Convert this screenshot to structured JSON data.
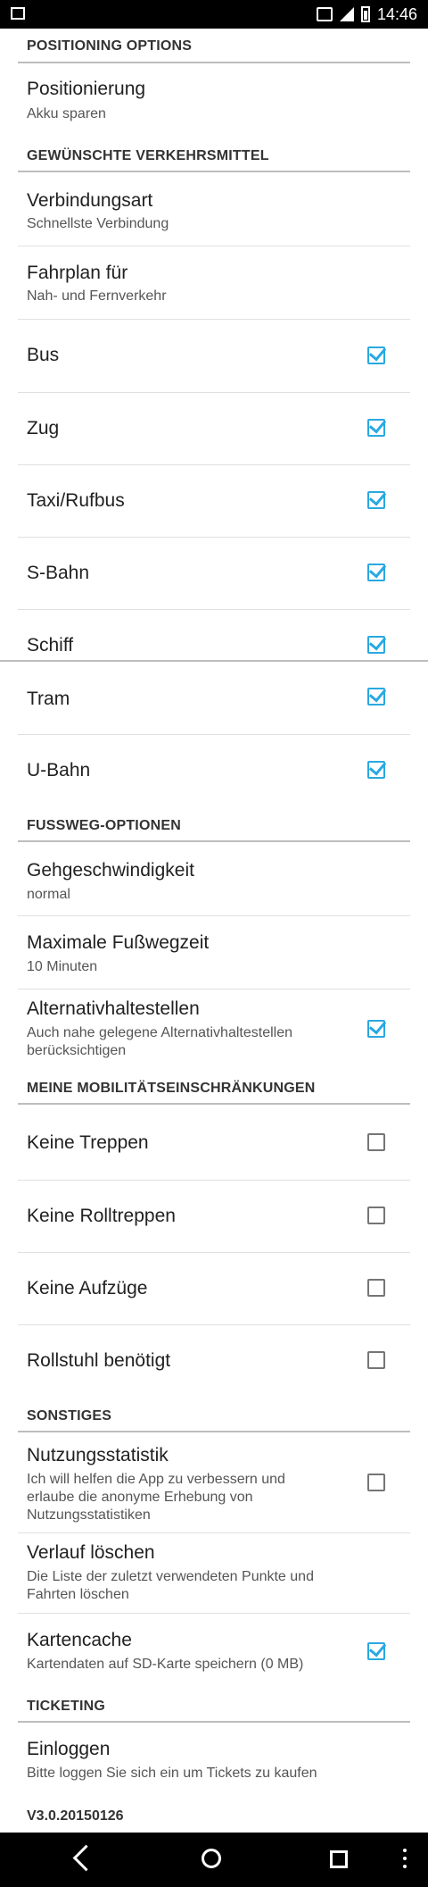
{
  "status_bar": {
    "time": "14:46"
  },
  "sections": {
    "positioning": {
      "header": "POSITIONING OPTIONS"
    },
    "transport": {
      "header": "GEWÜNSCHTE VERKEHRSMITTEL"
    },
    "walking": {
      "header": "FUSSWEG-OPTIONEN"
    },
    "mobility": {
      "header": "MEINE MOBILITÄTSEINSCHRÄNKUNGEN"
    },
    "misc": {
      "header": "SONSTIGES"
    },
    "ticketing": {
      "header": "TICKETING"
    }
  },
  "items": {
    "positionierung": {
      "title": "Positionierung",
      "subtitle": "Akku sparen"
    },
    "verbindungsart": {
      "title": "Verbindungsart",
      "subtitle": "Schnellste Verbindung"
    },
    "fahrplan": {
      "title": "Fahrplan für",
      "subtitle": "Nah- und Fernverkehr"
    },
    "bus": {
      "title": "Bus",
      "checked": true
    },
    "zug": {
      "title": "Zug",
      "checked": true
    },
    "taxi": {
      "title": "Taxi/Rufbus",
      "checked": true
    },
    "sbahn": {
      "title": "S-Bahn",
      "checked": true
    },
    "schiff": {
      "title": "Schiff",
      "checked": true
    },
    "tram": {
      "title": "Tram",
      "checked": true
    },
    "ubahn": {
      "title": "U-Bahn",
      "checked": true
    },
    "gehgeschwindigkeit": {
      "title": "Gehgeschwindigkeit",
      "subtitle": "normal"
    },
    "fusswegzeit": {
      "title": "Maximale Fußwegzeit",
      "subtitle": "10 Minuten"
    },
    "alternativ": {
      "title": "Alternativhaltestellen",
      "subtitle": "Auch nahe gelegene Alternativhaltestellen berücksichtigen",
      "checked": true
    },
    "treppen": {
      "title": "Keine Treppen",
      "checked": false
    },
    "rolltreppen": {
      "title": "Keine Rolltreppen",
      "checked": false
    },
    "aufzuege": {
      "title": "Keine Aufzüge",
      "checked": false
    },
    "rollstuhl": {
      "title": "Rollstuhl benötigt",
      "checked": false
    },
    "statistik": {
      "title": "Nutzungsstatistik",
      "subtitle": "Ich will helfen die App zu verbessern und erlaube die anonyme Erhebung von Nutzungsstatistiken",
      "checked": false
    },
    "verlauf": {
      "title": "Verlauf löschen",
      "subtitle": "Die Liste der zuletzt verwendeten Punkte und Fahrten löschen"
    },
    "kartencache": {
      "title": "Kartencache",
      "subtitle": "Kartendaten auf SD-Karte speichern (0 MB)",
      "checked": true
    },
    "einloggen": {
      "title": "Einloggen",
      "subtitle": "Bitte loggen Sie sich ein um Tickets zu kaufen"
    }
  },
  "version": "V3.0.20150126",
  "colors": {
    "accent": "#29a9e1",
    "statusbar": "#000000"
  }
}
